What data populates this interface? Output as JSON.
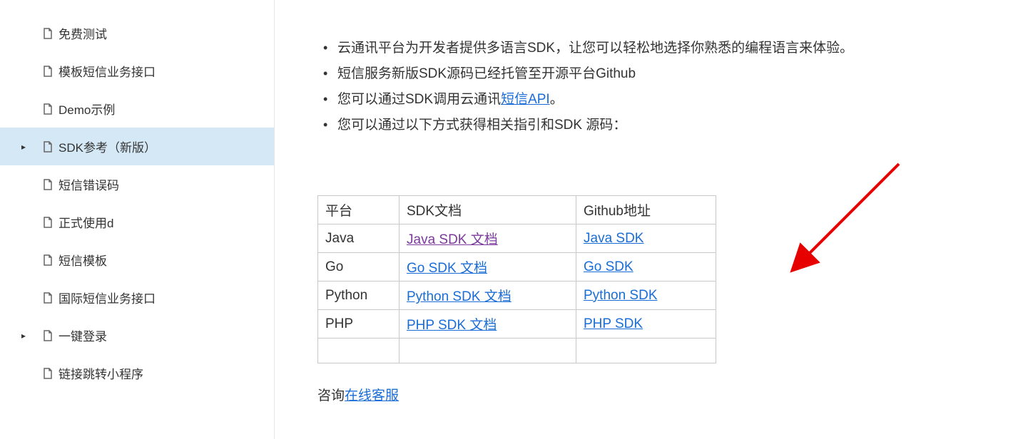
{
  "sidebar": {
    "items": [
      {
        "label": "免费测试",
        "active": false,
        "caret": false
      },
      {
        "label": "模板短信业务接口",
        "active": false,
        "caret": false
      },
      {
        "label": "Demo示例",
        "active": false,
        "caret": false
      },
      {
        "label": "SDK参考（新版）",
        "active": true,
        "caret": true
      },
      {
        "label": "短信错误码",
        "active": false,
        "caret": false
      },
      {
        "label": "正式使用d",
        "active": false,
        "caret": false
      },
      {
        "label": "短信模板",
        "active": false,
        "caret": false
      },
      {
        "label": "国际短信业务接口",
        "active": false,
        "caret": false
      },
      {
        "label": "一键登录",
        "active": false,
        "caret": true
      },
      {
        "label": "链接跳转小程序",
        "active": false,
        "caret": false
      }
    ]
  },
  "bullets": {
    "item1": "云通讯平台为开发者提供多语言SDK，让您可以轻松地选择你熟悉的编程语言来体验。",
    "item2": "短信服务新版SDK源码已经托管至开源平台Github",
    "item3_prefix": "您可以通过SDK调用云通讯",
    "item3_link": "短信API",
    "item3_suffix": "。",
    "item4": "您可以通过以下方式获得相关指引和SDK 源码："
  },
  "table": {
    "headers": {
      "platform": "平台",
      "doc": "SDK文档",
      "github": "Github地址"
    },
    "rows": [
      {
        "platform": "Java",
        "doc": "Java SDK 文档",
        "github": "Java SDK",
        "doc_visited": true
      },
      {
        "platform": "Go",
        "doc": "Go SDK 文档",
        "github": "Go SDK",
        "doc_visited": false
      },
      {
        "platform": "Python",
        "doc": "Python SDK 文档",
        "github": "Python SDK",
        "doc_visited": false
      },
      {
        "platform": "PHP",
        "doc": "PHP SDK 文档",
        "github": "PHP SDK",
        "doc_visited": false
      }
    ]
  },
  "footer": {
    "prefix": "咨询",
    "link": "在线客服"
  }
}
